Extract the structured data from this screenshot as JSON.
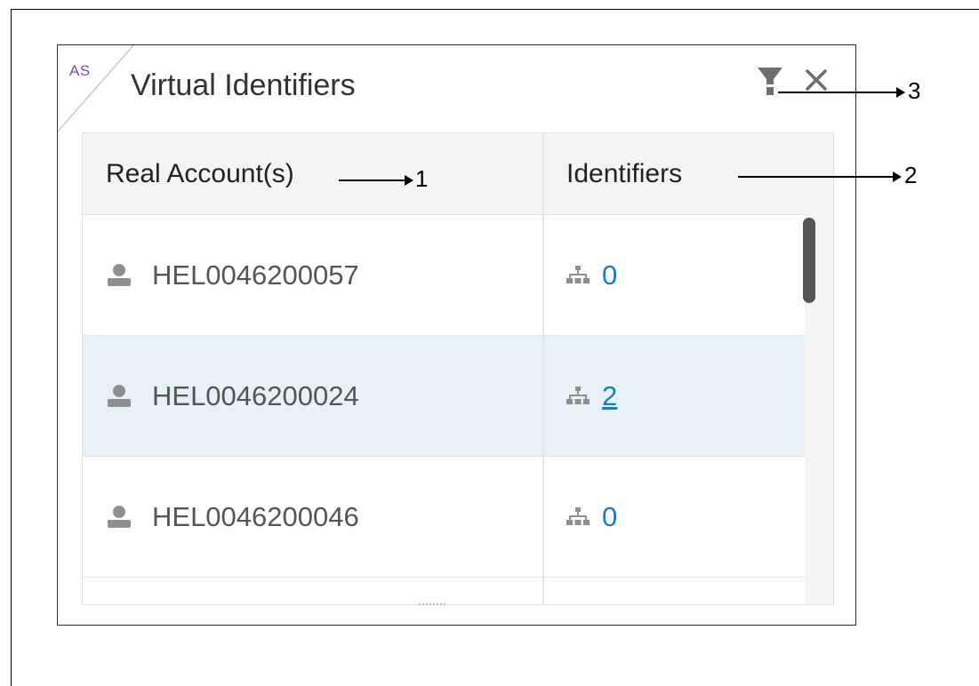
{
  "widget": {
    "corner_tag": "AS",
    "title": "Virtual Identifiers",
    "colors": {
      "link": "#1a7bbd",
      "selected_row": "#e6f1f8",
      "corner_tag": "#7a4fb5"
    }
  },
  "table": {
    "headers": {
      "account": "Real Account(s)",
      "identifiers": "Identifiers"
    },
    "rows": [
      {
        "account": "HEL0046200057",
        "identifiers": "0",
        "selected": false
      },
      {
        "account": "HEL0046200024",
        "identifiers": "2",
        "selected": true
      },
      {
        "account": "HEL0046200046",
        "identifiers": "0",
        "selected": false
      }
    ]
  },
  "callouts": {
    "one": "1",
    "two": "2",
    "three": "3"
  },
  "icons": {
    "filter": "filter-icon",
    "close": "close-icon",
    "user": "user-icon",
    "hierarchy": "hierarchy-icon"
  }
}
